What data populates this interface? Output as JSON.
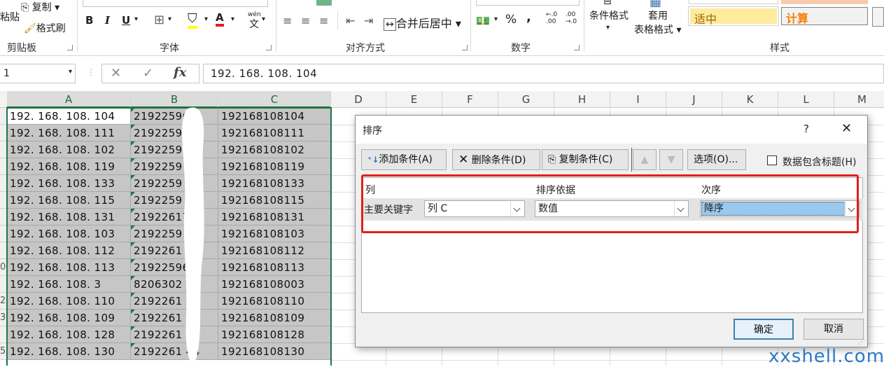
{
  "ribbon": {
    "clipboard": {
      "paste": "粘贴",
      "copy": "复制",
      "format_painter": "格式刷",
      "label": "剪贴板"
    },
    "font": {
      "bold": "B",
      "italic": "I",
      "underline": "U",
      "font_color": "A",
      "phonetic": "wén",
      "label": "字体"
    },
    "align": {
      "merge": "合并后居中",
      "label": "对齐方式"
    },
    "number": {
      "percent": "%",
      "comma": ",",
      "inc_decimal": "←.0\n.00",
      "dec_decimal": ".00\n→.0",
      "label": "数字"
    },
    "styles": {
      "conditional": "条件格式",
      "table_format_1": "套用",
      "table_format_2": "表格格式",
      "style_neutral": "适中",
      "style_calc": "计算",
      "label": "样式"
    },
    "colors": {
      "neutral_bg": "#ffeb9c",
      "neutral_fg": "#9c6500",
      "calc_bg": "#f2f2f2",
      "calc_fg": "#fa7d00"
    }
  },
  "formula_bar": {
    "name_box": "1",
    "cancel": "✕",
    "enter": "✓",
    "fx": "fx",
    "content": "192. 168. 108. 104"
  },
  "sheet": {
    "columns": [
      "A",
      "B",
      "C",
      "D",
      "E",
      "F",
      "G",
      "H",
      "I",
      "J",
      "K",
      "L",
      "M"
    ],
    "row_numbers": [
      "",
      "",
      "",
      "",
      "",
      "",
      "",
      "",
      "",
      "0",
      "",
      "2",
      "3",
      "",
      "5"
    ],
    "rows": [
      {
        "a": "192. 168. 108. 104",
        "b": "21922596  2",
        "c": "192168108104"
      },
      {
        "a": "192. 168. 108. 111",
        "b": "2192259  5",
        "c": "192168108111"
      },
      {
        "a": "192. 168. 108. 102",
        "b": "2192259",
        "c": "192168108102"
      },
      {
        "a": "192. 168. 108. 119",
        "b": "2192259",
        "c": "192168108119"
      },
      {
        "a": "192. 168. 108. 133",
        "b": "2192259",
        "c": "192168108133"
      },
      {
        "a": "192. 168. 108. 115",
        "b": "2192259",
        "c": "192168108115"
      },
      {
        "a": "192. 168. 108. 131",
        "b": "21922617  0",
        "c": "192168108131"
      },
      {
        "a": "192. 168. 108. 103",
        "b": "2192259  1",
        "c": "192168108103"
      },
      {
        "a": "192. 168. 108. 112",
        "b": "2192261  6",
        "c": "192168108112"
      },
      {
        "a": "192. 168. 108. 113",
        "b": "21922596  0",
        "c": "192168108113"
      },
      {
        "a": "192. 168. 108. 3",
        "b": "8206302",
        "c": "192168108003"
      },
      {
        "a": "192. 168. 108. 110",
        "b": "2192261  1",
        "c": "192168108110"
      },
      {
        "a": "192. 168. 108. 109",
        "b": "2192261  8",
        "c": "192168108109"
      },
      {
        "a": "192. 168. 108. 128",
        "b": "2192261  24",
        "c": "192168108128"
      },
      {
        "a": "192. 168. 108. 130",
        "b": "2192261  44",
        "c": "192168108130"
      }
    ]
  },
  "dialog": {
    "title": "排序",
    "help": "?",
    "close": "✕",
    "add_condition": "添加条件(A)",
    "delete_condition": "删除条件(D)",
    "copy_condition": "复制条件(C)",
    "options": "选项(O)...",
    "has_headers": "数据包含标题(H)",
    "col_header": "列",
    "sort_on_header": "排序依据",
    "order_header": "次序",
    "row_label": "主要关键字",
    "column_value": "列 C",
    "sort_on_value": "数值",
    "order_value": "降序",
    "ok": "确定",
    "cancel": "取消",
    "highlight_color": "#e0201b"
  },
  "watermark": "xxshell.com"
}
